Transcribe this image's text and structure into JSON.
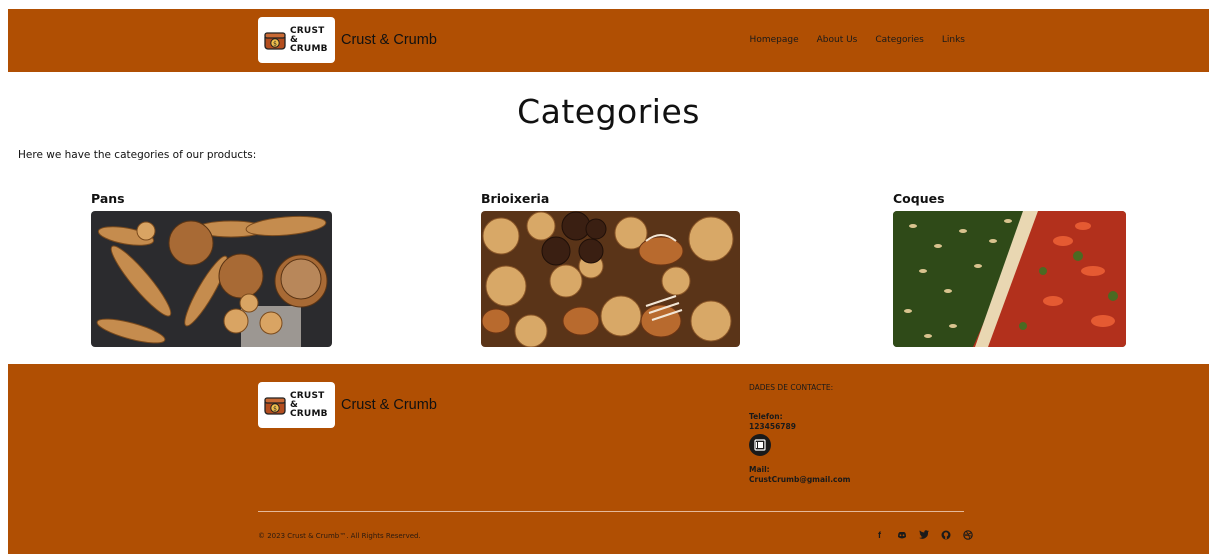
{
  "brand": {
    "name": "Crust & Crumb",
    "logo_lines": [
      "CRUST",
      "&",
      "CRUMB"
    ]
  },
  "nav": {
    "links": [
      "Homepage",
      "About Us",
      "Categories",
      "Links"
    ]
  },
  "page": {
    "title": "Categories",
    "intro": "Here we have the categories of our products:"
  },
  "categories": [
    {
      "name": "Pans"
    },
    {
      "name": "Brioixeria"
    },
    {
      "name": "Coques"
    }
  ],
  "footer": {
    "contact_header": "DADES DE CONTACTE:",
    "phone_label": "Telefon:",
    "phone": "123456789",
    "mail_label": "Mail:",
    "mail": "CrustCrumb@gmail.com",
    "copyright": "© 2023 Crust & Crumb™. All Rights Reserved.",
    "social_icons": [
      "facebook-icon",
      "discord-icon",
      "twitter-icon",
      "github-icon",
      "dribbble-icon"
    ]
  },
  "colors": {
    "brand_orange": "#b04f03",
    "text_dark": "#111111"
  }
}
